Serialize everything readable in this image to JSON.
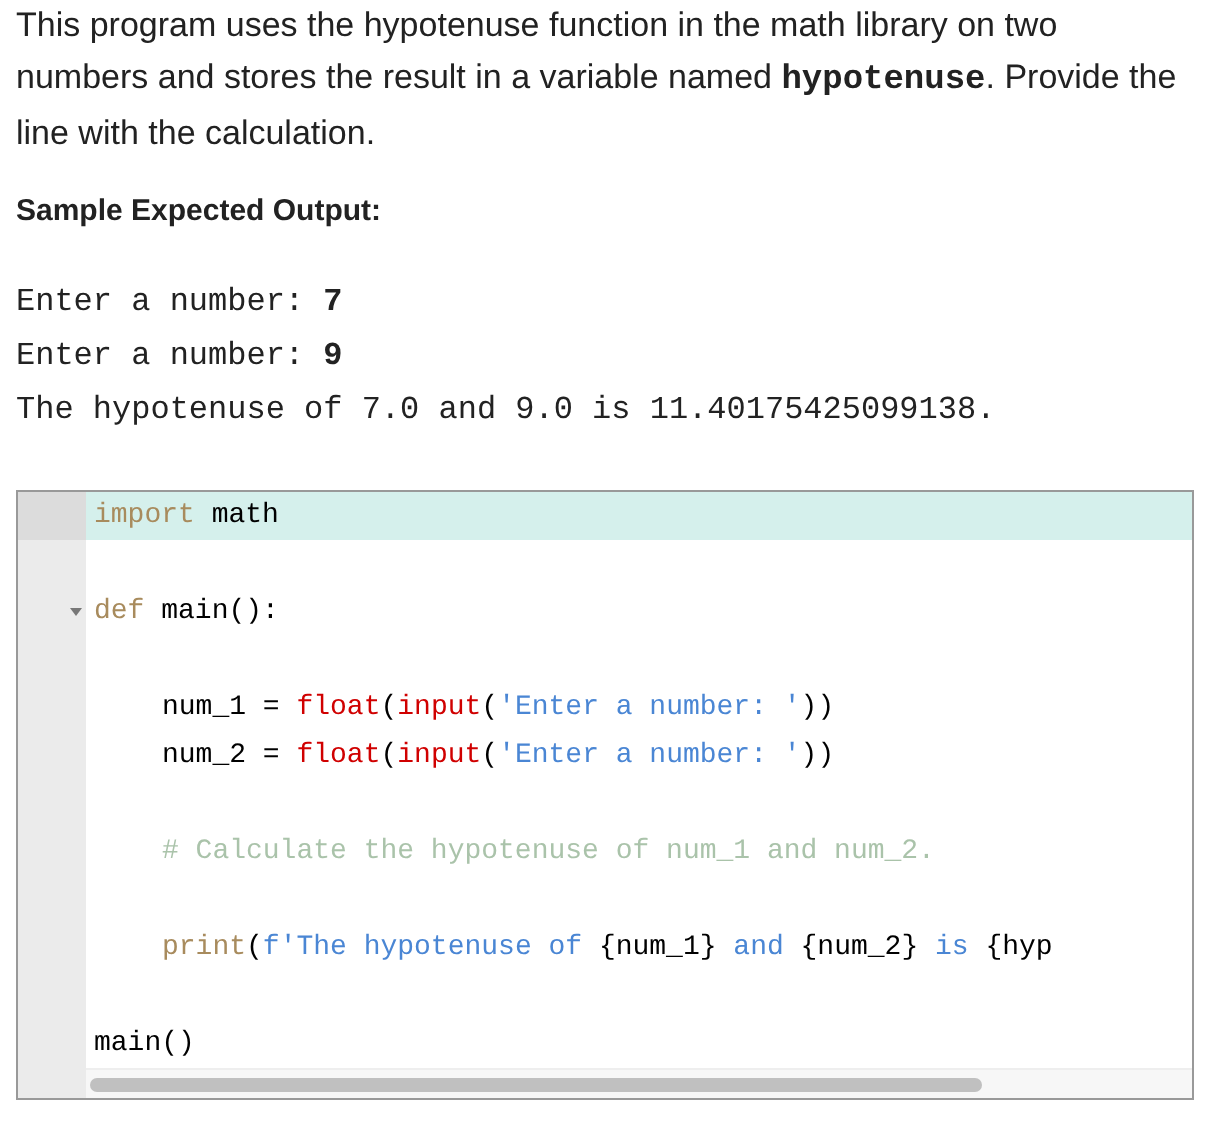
{
  "instructions": [
    {
      "kind": "text",
      "text": "This program uses the hypotenuse function in the math library on two numbers and stores the result in a variable named "
    },
    {
      "kind": "code",
      "text": "hypotenuse"
    },
    {
      "kind": "text",
      "text": ". Provide the line with the calculation."
    }
  ],
  "output_heading": "Sample Expected Output:",
  "sample_output": [
    "Enter a number: **7**",
    "Enter a number: **9**",
    "The hypotenuse of 7.0 and 9.0 is 11.40175425099138."
  ],
  "editor": {
    "lines": [
      {
        "active": true,
        "indented": false,
        "tokens": [
          {
            "kind": "keyword",
            "text": "import"
          },
          {
            "kind": "plain",
            "text": " math"
          }
        ]
      },
      {
        "active": false
      },
      {
        "active": false,
        "indented": false,
        "fold_expanded": true,
        "tokens": [
          {
            "kind": "keyword",
            "text": "def"
          },
          {
            "kind": "plain",
            "text": " main():"
          }
        ]
      },
      {
        "active": false
      },
      {
        "active": false,
        "indented": true,
        "tokens": [
          {
            "kind": "plain",
            "text": "num_1 = "
          },
          {
            "kind": "builtin",
            "text": "float"
          },
          {
            "kind": "plain",
            "text": "("
          },
          {
            "kind": "builtin",
            "text": "input"
          },
          {
            "kind": "plain",
            "text": "("
          },
          {
            "kind": "string",
            "text": "'Enter a number: '"
          },
          {
            "kind": "plain",
            "text": "))"
          }
        ]
      },
      {
        "active": false,
        "indented": true,
        "tokens": [
          {
            "kind": "plain",
            "text": "num_2 = "
          },
          {
            "kind": "builtin",
            "text": "float"
          },
          {
            "kind": "plain",
            "text": "("
          },
          {
            "kind": "builtin",
            "text": "input"
          },
          {
            "kind": "plain",
            "text": "("
          },
          {
            "kind": "string",
            "text": "'Enter a number: '"
          },
          {
            "kind": "plain",
            "text": "))"
          }
        ]
      },
      {
        "active": false
      },
      {
        "active": false,
        "indented": true,
        "tokens": [
          {
            "kind": "comment",
            "text": "# Calculate the hypotenuse of num_1 and num_2."
          }
        ]
      },
      {
        "active": false
      },
      {
        "active": false,
        "indented": true,
        "tokens": [
          {
            "kind": "keyword",
            "text": "print"
          },
          {
            "kind": "plain",
            "text": "("
          },
          {
            "kind": "string",
            "text": "f'The hypotenuse of "
          },
          {
            "kind": "plain",
            "text": "{num_1} "
          },
          {
            "kind": "string",
            "text": "and "
          },
          {
            "kind": "plain",
            "text": "{num_2} "
          },
          {
            "kind": "string",
            "text": "is "
          },
          {
            "kind": "plain",
            "text": "{hyp"
          }
        ]
      },
      {
        "active": false
      },
      {
        "active": false,
        "indented": false,
        "tokens": [
          {
            "kind": "plain",
            "text": "main()"
          }
        ]
      }
    ]
  }
}
